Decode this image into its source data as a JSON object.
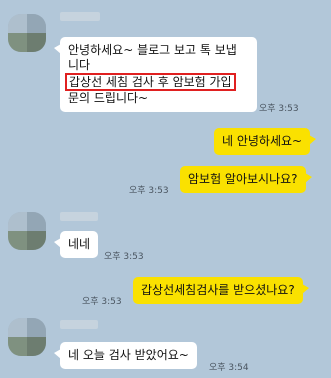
{
  "messages": [
    {
      "sender": "other",
      "lines": [
        "안녕하세요~ 블로그 보고 톡 보냅",
        "니다",
        "갑상선 세침 검사 후 암보험 가입",
        "문의 드립니다~"
      ],
      "time": "오후 3:53"
    },
    {
      "sender": "me",
      "text": "네 안녕하세요~",
      "time": ""
    },
    {
      "sender": "me",
      "text": "암보험 알아보시나요?",
      "time": "오후 3:53"
    },
    {
      "sender": "other",
      "text": "네네",
      "time": "오후 3:53"
    },
    {
      "sender": "me",
      "text": "갑상선세침검사를 받으셨나요?",
      "time": "오후 3:53"
    },
    {
      "sender": "other",
      "text": "네 오늘 검사 받았어요~",
      "time": "오후 3:54"
    }
  ],
  "colors": {
    "background": "#b2c7d9",
    "incoming_bubble": "#ffffff",
    "outgoing_bubble": "#fae100",
    "highlight_box": "#e02020"
  }
}
